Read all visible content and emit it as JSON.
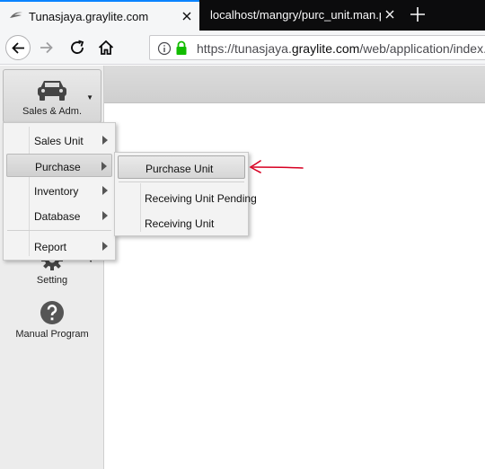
{
  "browser": {
    "tabs": [
      {
        "title": "Tunasjaya.graylite.com",
        "active": true
      },
      {
        "title": "localhost/mangry/purc_unit.man.p",
        "active": false
      }
    ],
    "url_prefix": "https://tunasjaya.",
    "url_domain": "graylite.com",
    "url_path": "/web/application/index."
  },
  "sidebar": {
    "modules": [
      {
        "label": "Sales & Adm.",
        "icon": "car-icon",
        "has_dropdown": true
      },
      {
        "label": "Setting",
        "icon": "gear-icon",
        "has_dropdown": true
      },
      {
        "label": "Manual Program",
        "icon": "help-icon",
        "has_dropdown": false
      }
    ]
  },
  "menu": {
    "items": [
      {
        "label": "Sales Unit",
        "has_submenu": true
      },
      {
        "label": "Purchase",
        "has_submenu": true,
        "highlighted": true
      },
      {
        "label": "Inventory",
        "has_submenu": true
      },
      {
        "label": "Database",
        "has_submenu": true
      },
      {
        "label": "Report",
        "has_submenu": true
      }
    ],
    "submenu": [
      {
        "label": "Purchase Unit",
        "highlighted": true
      },
      {
        "label": "Receiving Unit Pending"
      },
      {
        "label": "Receiving Unit"
      }
    ]
  },
  "colors": {
    "tab_accent": "#0a84ff",
    "secure_lock": "#12bc00",
    "annotation_arrow": "#d70022"
  }
}
